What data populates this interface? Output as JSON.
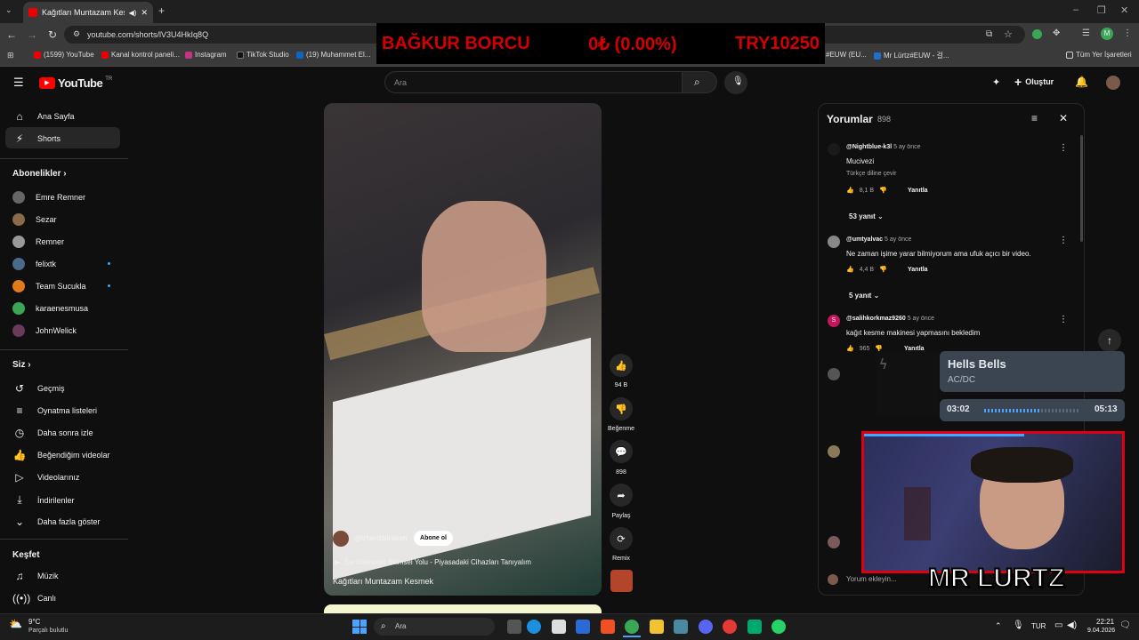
{
  "browser": {
    "tab_title": "Kağıtları Muntazam Kesmek",
    "url": "youtube.com/shorts/lV3U4HkIq8Q",
    "bookmarks": [
      "(1599) YouTube",
      "Kanal kontrol paneli...",
      "Instagram",
      "TikTok Studio",
      "(19) Muhammet El...",
      "#EUW (EU...",
      "Mr Lürtz#EUW - 걸...",
      "Tüm Yer İşaretleri"
    ]
  },
  "overlay": {
    "label": "BAĞKUR BORCU",
    "change": "0₺ (0.00%)",
    "amount": "TRY10250"
  },
  "header": {
    "logo": "YouTube",
    "logo_region": "TR",
    "search_placeholder": "Ara",
    "create_label": "Oluştur"
  },
  "sidebar": {
    "main": [
      {
        "label": "Ana Sayfa",
        "icon": "home-icon"
      },
      {
        "label": "Shorts",
        "icon": "shorts-icon"
      }
    ],
    "subs_title": "Abonelikler",
    "subs": [
      "Emre Remner",
      "Sezar",
      "Remner",
      "felixtk",
      "Team Sucukla",
      "karaenesmusa",
      "JohnWelick"
    ],
    "you_title": "Siz",
    "you": [
      {
        "label": "Geçmiş",
        "icon": "history-icon"
      },
      {
        "label": "Oynatma listeleri",
        "icon": "playlist-icon"
      },
      {
        "label": "Daha sonra izle",
        "icon": "clock-icon"
      },
      {
        "label": "Beğendiğim videolar",
        "icon": "like-icon"
      },
      {
        "label": "Videolarınız",
        "icon": "video-icon"
      },
      {
        "label": "İndirilenler",
        "icon": "download-icon"
      },
      {
        "label": "Daha fazla göster",
        "icon": "chevron-down-icon"
      }
    ],
    "explore_title": "Keşfet",
    "explore": [
      {
        "label": "Müzik",
        "icon": "music-icon"
      },
      {
        "label": "Canlı",
        "icon": "live-icon"
      }
    ]
  },
  "video": {
    "channel": "@irfanizbirakan",
    "subscribe": "Abone ol",
    "playlist": "Serinlemenin Bilimsel Yolu - Piyasadaki Cihazları Tanıyalım",
    "title": "Kağıtları Muntazam Kesmek",
    "likes": "94 B",
    "dislike_label": "Beğenme",
    "comments": "898",
    "share_label": "Paylaş",
    "remix_label": "Remix"
  },
  "comments": {
    "title": "Yorumlar",
    "count": "898",
    "add_placeholder": "Yorum ekleyin...",
    "items": [
      {
        "user": "@Nightblue-k3l",
        "time": "5 ay önce",
        "text": "Mucivezi",
        "extra": "Türkçe diline çevir",
        "likes": "8,1 B",
        "reply": "Yanıtla",
        "replies": "53 yanıt"
      },
      {
        "user": "@umtyalvac",
        "time": "5 ay önce",
        "text": "Ne zaman işime yarar bilmiyorum ama ufuk açıcı bir video.",
        "likes": "4,4 B",
        "reply": "Yanıtla",
        "replies": "5 yanıt"
      },
      {
        "user": "@salihkorkmaz9260",
        "time": "5 ay önce",
        "text": "kağıt kesme makinesi yapmasını bekledim",
        "likes": "965",
        "reply": "Yanıtla"
      }
    ]
  },
  "music": {
    "title": "Hells Bells",
    "artist": "AC/DC",
    "elapsed": "03:02",
    "total": "05:13",
    "progress": 0.58
  },
  "stream_label": "MR LURTZ",
  "taskbar": {
    "temp": "9°C",
    "weather": "Parçalı bulutlu",
    "search": "Ara",
    "lang": "TUR",
    "time": "22:21",
    "date": "9.04.2026"
  }
}
